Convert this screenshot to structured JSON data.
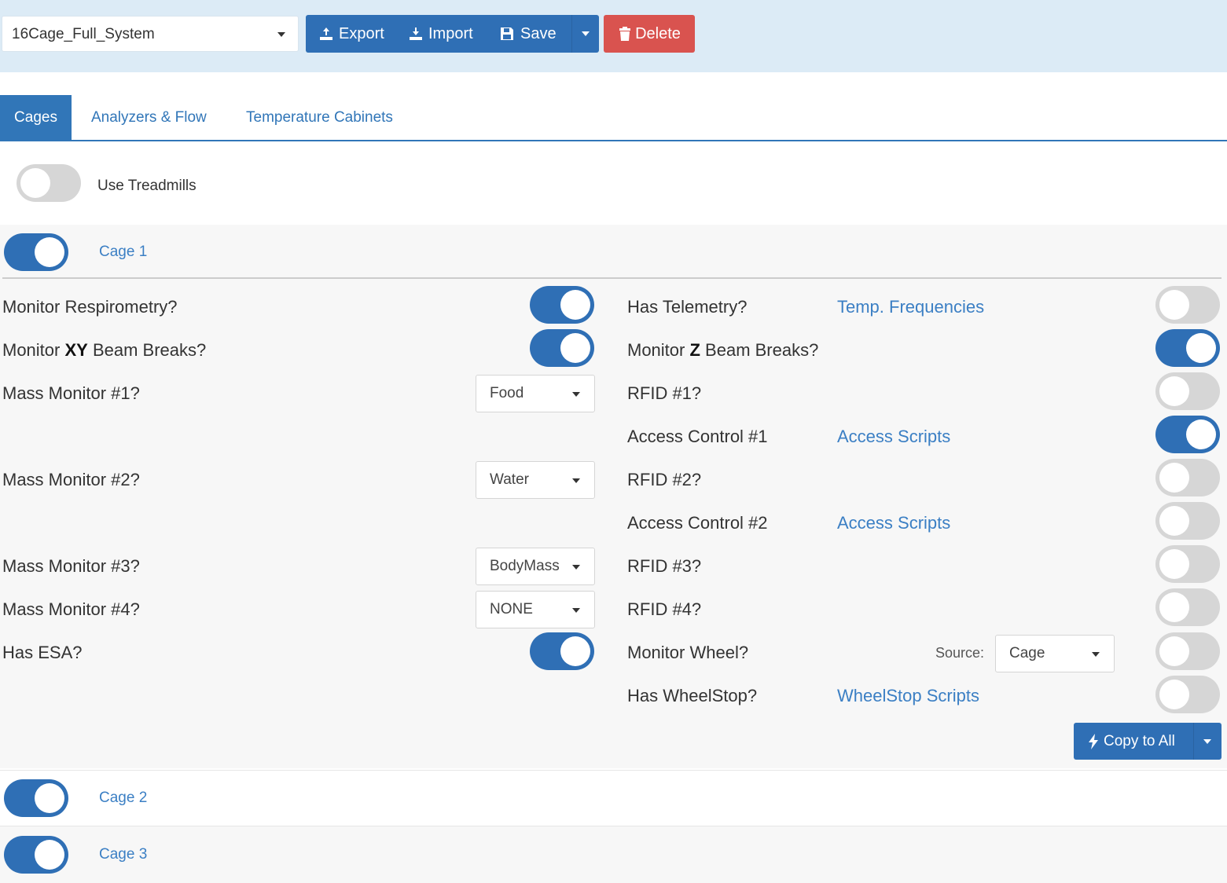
{
  "toolbar": {
    "config_value": "16Cage_Full_System",
    "export_label": "Export",
    "import_label": "Import",
    "save_label": "Save",
    "delete_label": "Delete"
  },
  "tabs": [
    {
      "label": "Cages",
      "active": true
    },
    {
      "label": "Analyzers & Flow",
      "active": false
    },
    {
      "label": "Temperature Cabinets",
      "active": false
    }
  ],
  "use_treadmills": {
    "label": "Use Treadmills",
    "on": false
  },
  "cages": [
    {
      "label": "Cage 1",
      "on": true
    },
    {
      "label": "Cage 2",
      "on": true
    },
    {
      "label": "Cage 3",
      "on": true
    }
  ],
  "cage1": {
    "left": {
      "respirometry": {
        "label": "Monitor Respirometry?",
        "on": true
      },
      "xy_beam": {
        "prefix": "Monitor ",
        "bold": "XY",
        "suffix": " Beam Breaks?",
        "on": true
      },
      "mass1": {
        "label": "Mass Monitor #1?",
        "value": "Food"
      },
      "mass2": {
        "label": "Mass Monitor #2?",
        "value": "Water"
      },
      "mass3": {
        "label": "Mass Monitor #3?",
        "value": "BodyMass"
      },
      "mass4": {
        "label": "Mass Monitor #4?",
        "value": "NONE"
      },
      "esa": {
        "label": "Has ESA?",
        "on": true
      }
    },
    "right": {
      "telemetry": {
        "label": "Has Telemetry?",
        "link": "Temp. Frequencies",
        "on": false
      },
      "z_beam": {
        "prefix": "Monitor ",
        "bold": "Z",
        "suffix": " Beam Breaks?",
        "on": true
      },
      "rfid1": {
        "label": "RFID #1?",
        "on": false
      },
      "access1": {
        "label": "Access Control #1",
        "link": "Access Scripts",
        "on": true
      },
      "rfid2": {
        "label": "RFID #2?",
        "on": false
      },
      "access2": {
        "label": "Access Control #2",
        "link": "Access Scripts",
        "on": false
      },
      "rfid3": {
        "label": "RFID #3?",
        "on": false
      },
      "rfid4": {
        "label": "RFID #4?",
        "on": false
      },
      "wheel": {
        "label": "Monitor Wheel?",
        "source_label": "Source:",
        "source_value": "Cage",
        "on": false
      },
      "wheelstop": {
        "label": "Has WheelStop?",
        "link": "WheelStop Scripts",
        "on": false
      }
    },
    "copy_label": "Copy to All"
  },
  "colors": {
    "primary": "#2f6fb5",
    "danger": "#d9534f",
    "topbar": "#dcebf6",
    "link": "#3b7fc4"
  }
}
